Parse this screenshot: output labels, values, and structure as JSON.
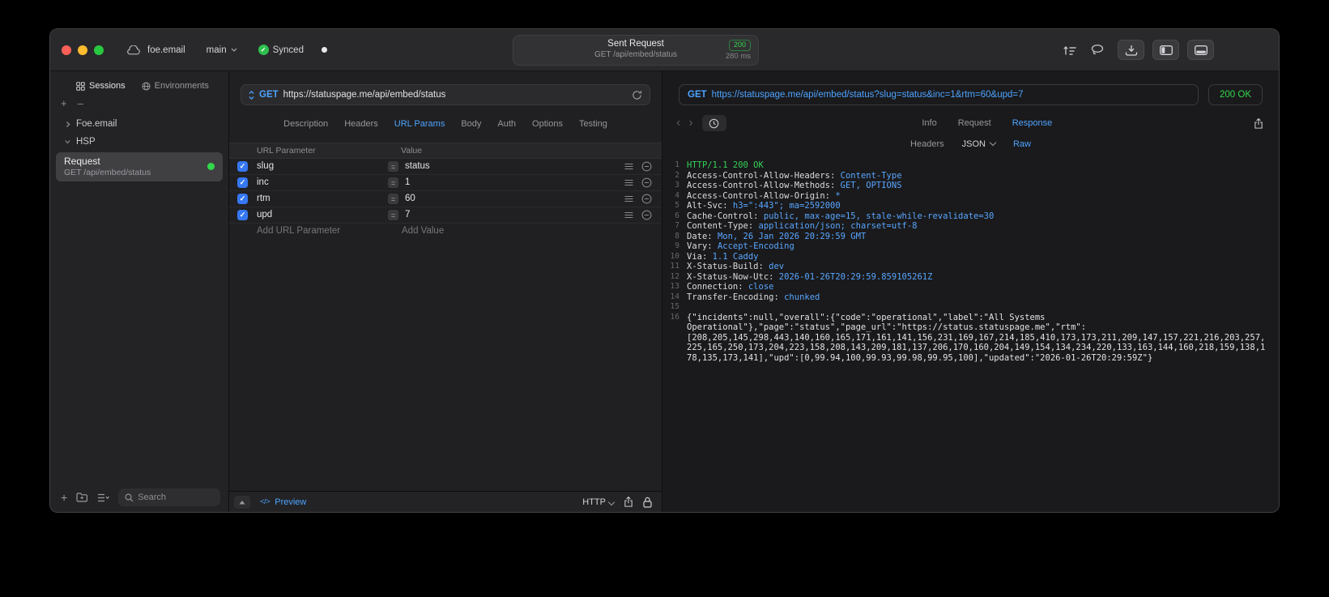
{
  "colors": {
    "accent_blue": "#4da3ff",
    "success_green": "#32d74b"
  },
  "titlebar": {
    "project": "foe.email",
    "branch": "main",
    "sync": "Synced",
    "center": {
      "title": "Sent Request",
      "status": "200",
      "subtitle": "GET /api/embed/status",
      "duration": "280 ms"
    }
  },
  "sidebar": {
    "tabs": [
      {
        "label": "Sessions"
      },
      {
        "label": "Environments"
      }
    ],
    "controls": {
      "add": "+",
      "remove": "–"
    },
    "groups": [
      {
        "label": "Foe.email",
        "expanded": false
      },
      {
        "label": "HSP",
        "expanded": true
      }
    ],
    "request_item": {
      "title": "Request",
      "subtitle": "GET /api/embed/status"
    },
    "footer_add": "+",
    "search_placeholder": "Search"
  },
  "request_editor": {
    "method": "GET",
    "url": "https://statuspage.me/api/embed/status",
    "tabs": [
      "Description",
      "Headers",
      "URL Params",
      "Body",
      "Auth",
      "Options",
      "Testing"
    ],
    "active_tab": "URL Params",
    "params": {
      "columns": [
        "URL Parameter",
        "Value"
      ],
      "rows": [
        {
          "name": "slug",
          "value": "status",
          "enabled": true
        },
        {
          "name": "inc",
          "value": "1",
          "enabled": true
        },
        {
          "name": "rtm",
          "value": "60",
          "enabled": true
        },
        {
          "name": "upd",
          "value": "7",
          "enabled": true
        }
      ],
      "add_name": "Add URL Parameter",
      "add_value": "Add Value"
    },
    "footer": {
      "preview_icon": "</>",
      "preview": "Preview",
      "protocol": "HTTP"
    }
  },
  "response_viewer": {
    "method": "GET",
    "url": "https://statuspage.me/api/embed/status?slug=status&inc=1&rtm=60&upd=7",
    "status": "200 OK",
    "nav": {
      "back": "‹",
      "forward": "›"
    },
    "tabs": [
      "Info",
      "Request",
      "Response"
    ],
    "active_tab": "Response",
    "subtabs": [
      "Headers",
      "JSON",
      "Raw"
    ],
    "active_subtab": "Raw",
    "status_line": "HTTP/1.1 200 OK",
    "headers": [
      {
        "name": "Access-Control-Allow-Headers",
        "value": "Content-Type"
      },
      {
        "name": "Access-Control-Allow-Methods",
        "value": "GET, OPTIONS"
      },
      {
        "name": "Access-Control-Allow-Origin",
        "value": "*"
      },
      {
        "name": "Alt-Svc",
        "value": "h3=\":443\"; ma=2592000"
      },
      {
        "name": "Cache-Control",
        "value": "public, max-age=15, stale-while-revalidate=30"
      },
      {
        "name": "Content-Type",
        "value": "application/json; charset=utf-8"
      },
      {
        "name": "Date",
        "value": "Mon, 26 Jan 2026 20:29:59 GMT"
      },
      {
        "name": "Vary",
        "value": "Accept-Encoding"
      },
      {
        "name": "Via",
        "value": "1.1 Caddy"
      },
      {
        "name": "X-Status-Build",
        "value": "dev"
      },
      {
        "name": "X-Status-Now-Utc",
        "value": "2026-01-26T20:29:59.859105261Z"
      },
      {
        "name": "Connection",
        "value": "close"
      },
      {
        "name": "Transfer-Encoding",
        "value": "chunked"
      }
    ],
    "body": "{\"incidents\":null,\"overall\":{\"code\":\"operational\",\"label\":\"All Systems Operational\"},\"page\":\"status\",\"page_url\":\"https://status.statuspage.me\",\"rtm\":[208,205,145,298,443,140,160,165,171,161,141,156,231,169,167,214,185,410,173,173,211,209,147,157,221,216,203,257,225,165,250,173,204,223,158,208,143,209,181,137,206,170,160,204,149,154,134,234,220,133,163,144,160,218,159,138,178,135,173,141],\"upd\":[0,99.94,100,99.93,99.98,99.95,100],\"updated\":\"2026-01-26T20:29:59Z\"}"
  }
}
